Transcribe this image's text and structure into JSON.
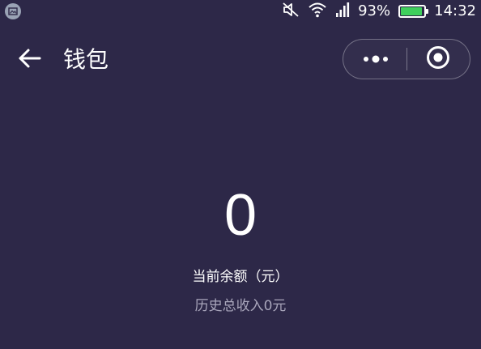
{
  "status_bar": {
    "battery_percent_text": "93%",
    "battery_level": 0.93,
    "time": "14:32",
    "battery_color": "#3fcf5c"
  },
  "nav": {
    "title": "钱包",
    "back_icon": "arrow-left-icon",
    "more_icon": "more-dots-icon",
    "close_icon": "target-circle-icon"
  },
  "wallet": {
    "balance": "0",
    "balance_label": "当前余额（元）",
    "history_income": "历史总收入0元"
  },
  "colors": {
    "background": "#2d2848",
    "text_primary": "#ffffff",
    "text_secondary": "#a9a6bb"
  }
}
